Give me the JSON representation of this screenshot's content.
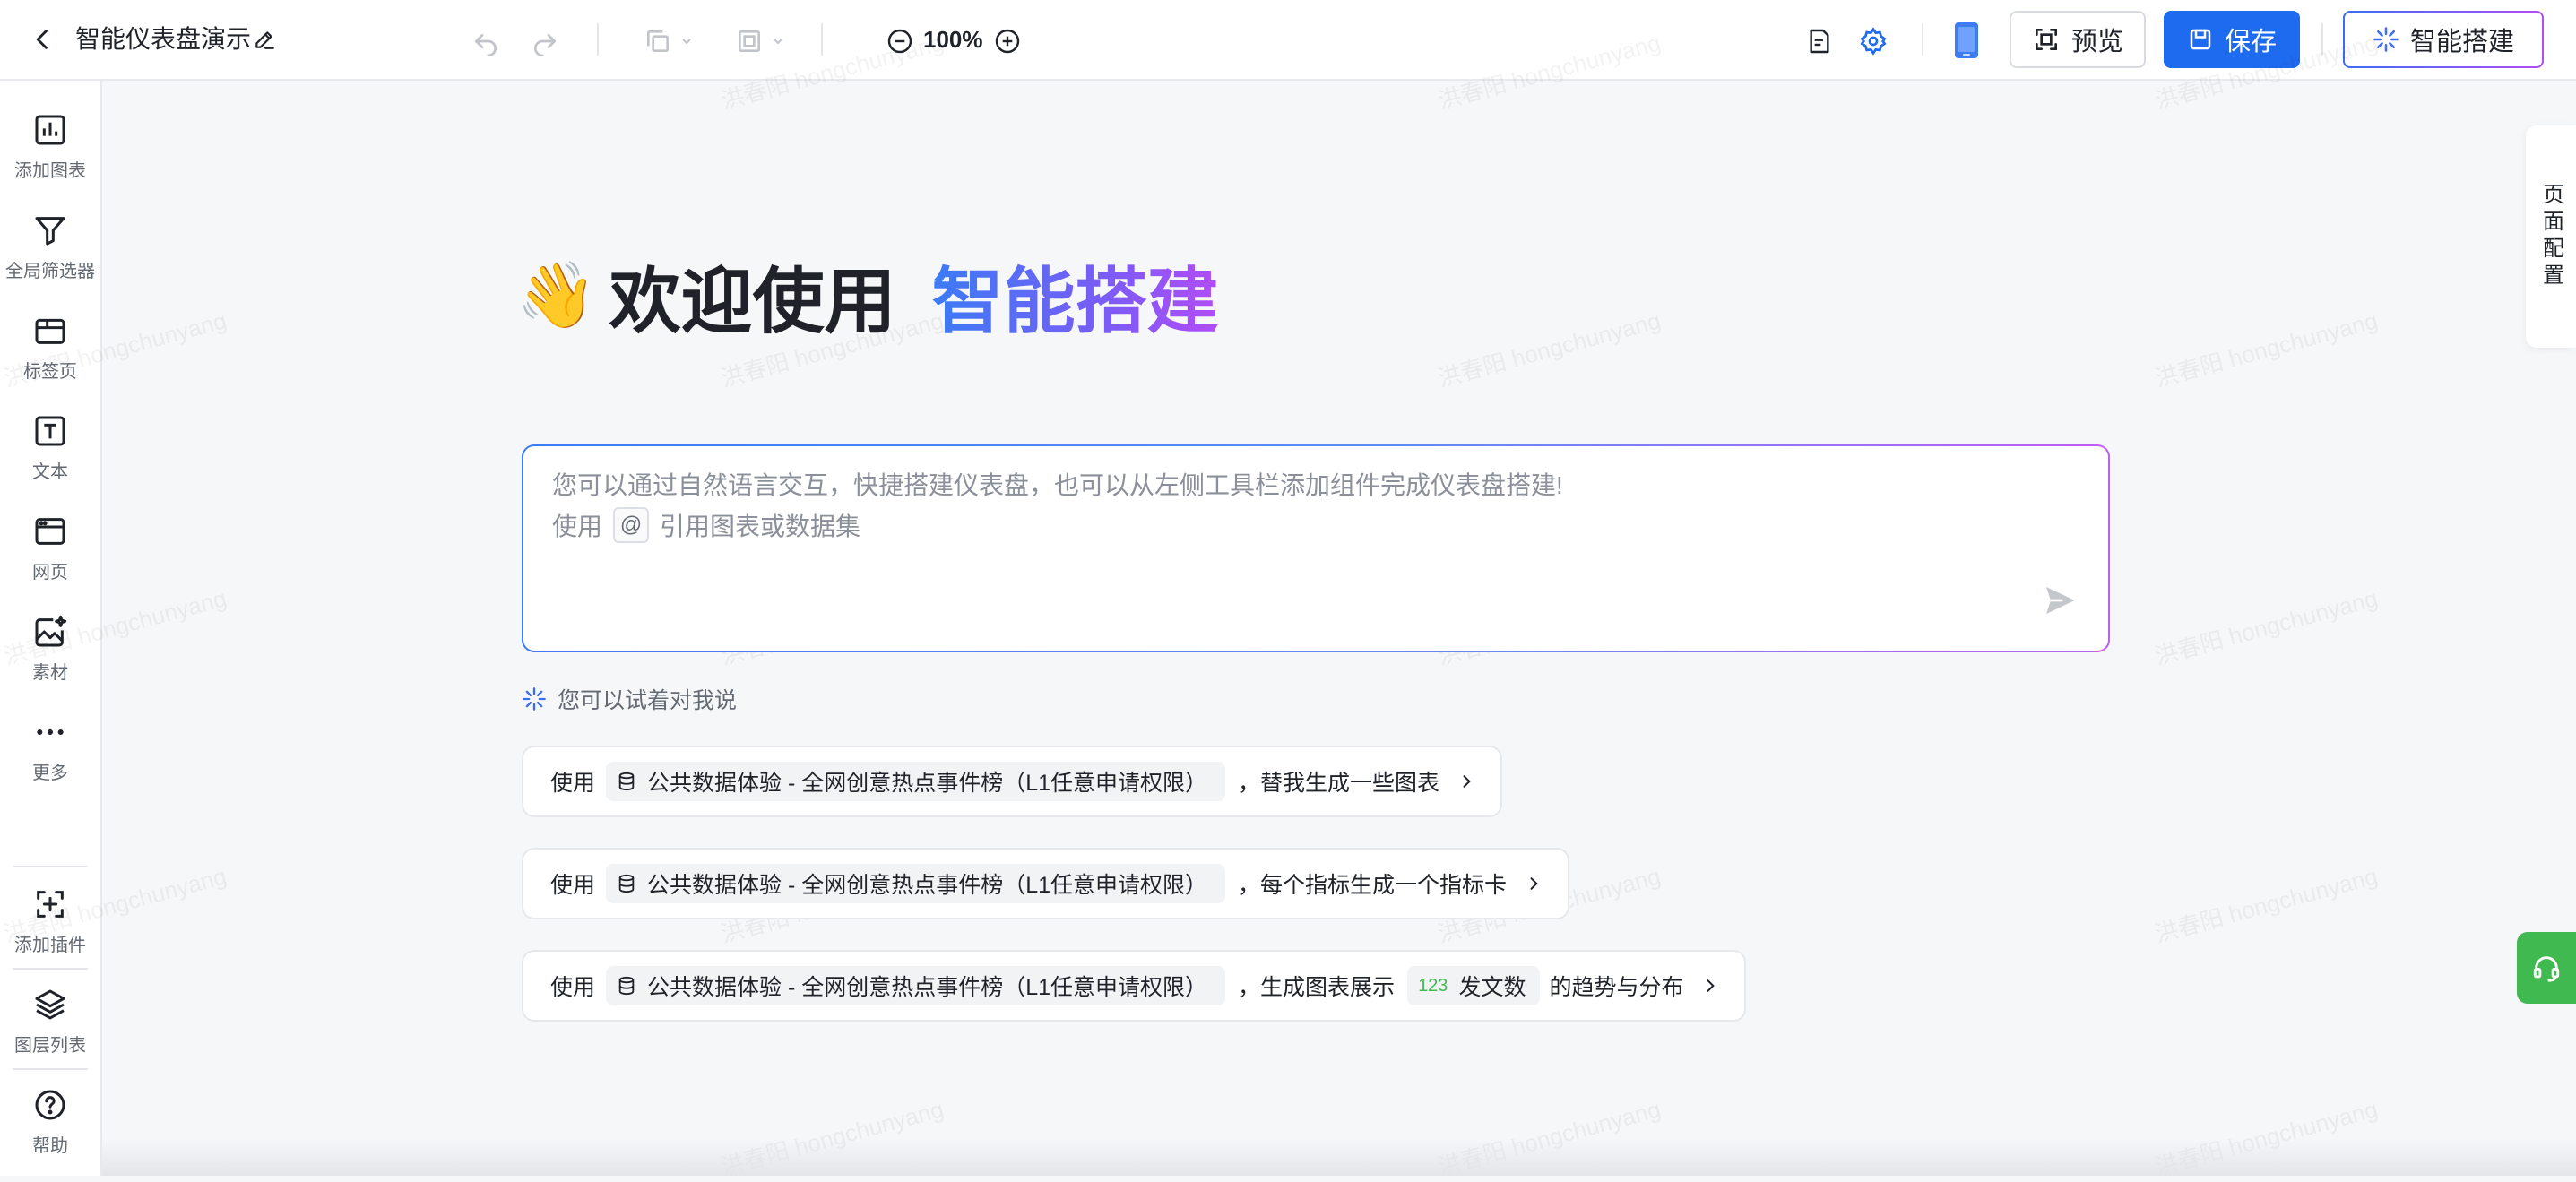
{
  "topbar": {
    "title": "智能仪表盘演示",
    "zoom": "100%",
    "preview_label": "预览",
    "save_label": "保存",
    "ai_build_label": "智能搭建"
  },
  "sidebar": {
    "items": [
      {
        "label": "添加图表",
        "icon": "bar-chart-icon"
      },
      {
        "label": "全局筛选器",
        "icon": "filter-icon"
      },
      {
        "label": "标签页",
        "icon": "tabs-icon"
      },
      {
        "label": "文本",
        "icon": "text-icon"
      },
      {
        "label": "网页",
        "icon": "webpage-icon"
      },
      {
        "label": "素材",
        "icon": "material-icon"
      },
      {
        "label": "更多",
        "icon": "more-icon"
      }
    ],
    "bottom_items": [
      {
        "label": "添加插件",
        "icon": "add-plugin-icon"
      },
      {
        "label": "图层列表",
        "icon": "layers-icon"
      },
      {
        "label": "帮助",
        "icon": "help-icon"
      }
    ]
  },
  "right_panel": {
    "page_config": "页面配置"
  },
  "welcome": {
    "emoji": "👋",
    "text": "欢迎使用",
    "brand": "智能搭建"
  },
  "prompt": {
    "line1": "您可以通过自然语言交互，快捷搭建仪表盘，也可以从左侧工具栏添加组件完成仪表盘搭建!",
    "line2_before": "使用",
    "at_symbol": "@",
    "line2_after": "引用图表或数据集"
  },
  "try_hint": "您可以试着对我说",
  "suggestions": [
    {
      "prefix": "使用",
      "dataset": "公共数据体验 - 全网创意热点事件榜（L1任意申请权限）",
      "suffix": "，替我生成一些图表"
    },
    {
      "prefix": "使用",
      "dataset": "公共数据体验 - 全网创意热点事件榜（L1任意申请权限）",
      "suffix": "，每个指标生成一个指标卡"
    },
    {
      "prefix": "使用",
      "dataset": "公共数据体验 - 全网创意热点事件榜（L1任意申请权限）",
      "suffix": "，生成图表展示",
      "field_type": "123",
      "field": "发文数",
      "suffix2": "的趋势与分布"
    }
  ],
  "watermark": "洪春阳 hongchunyang",
  "colors": {
    "accent": "#1f6bf0",
    "gradient_start": "#3b7bf6",
    "gradient_end": "#b24cf6",
    "success": "#3fb950"
  }
}
